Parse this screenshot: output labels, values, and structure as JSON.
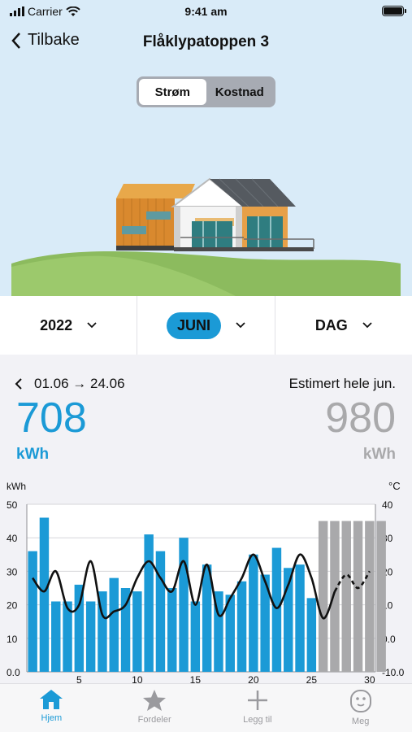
{
  "status_bar": {
    "carrier": "Carrier",
    "time": "9:41 am"
  },
  "nav": {
    "back_label": "Tilbake",
    "title": "Flåklypatoppen 3"
  },
  "segmented": {
    "options": [
      "Strøm",
      "Kostnad"
    ],
    "selected": "Strøm"
  },
  "selectors": {
    "year": "2022",
    "month": "JUNI",
    "granularity": "DAG"
  },
  "summary": {
    "period": "01.06 → 24.06",
    "used_value": "708",
    "used_unit": "kWh",
    "estimate_label": "Estimert hele jun.",
    "estimate_value": "980",
    "estimate_unit": "kWh"
  },
  "chart_data": {
    "type": "bar",
    "y_left_label": "kWh",
    "y_right_label": "°C",
    "y_left_ticks": [
      "50",
      "40",
      "30",
      "20",
      "10",
      "0.0"
    ],
    "y_right_ticks": [
      "40",
      "30",
      "20",
      "10",
      "0.0",
      "-10.0"
    ],
    "ylim": [
      0,
      50
    ],
    "y2lim": [
      -10,
      40
    ],
    "x_ticks": [
      "5",
      "10",
      "15",
      "20",
      "25",
      "30"
    ],
    "x_tick_values": [
      5,
      10,
      15,
      20,
      25,
      30
    ],
    "days": [
      1,
      2,
      3,
      4,
      5,
      6,
      7,
      8,
      9,
      10,
      11,
      12,
      13,
      14,
      15,
      16,
      17,
      18,
      19,
      20,
      21,
      22,
      23,
      24,
      25,
      26,
      27,
      28,
      29,
      30
    ],
    "actual_kwh": [
      36,
      46,
      21,
      21,
      26,
      21,
      24,
      28,
      25,
      24,
      41,
      36,
      25,
      40,
      21,
      32,
      24,
      23,
      27,
      35,
      29,
      37,
      31,
      32,
      22
    ],
    "estimated_kwh": [
      45,
      45,
      45,
      45,
      45,
      45
    ],
    "temperature_c": [
      18,
      14,
      20,
      9,
      10,
      23,
      7,
      8,
      10,
      18,
      23,
      18,
      14,
      23,
      10,
      22,
      7,
      12,
      18,
      25,
      17,
      9,
      16,
      25,
      18,
      6,
      14,
      19,
      15,
      20
    ],
    "colors": {
      "actual": "#1b9ad6",
      "estimated": "#a9a9ab",
      "temperature": "#111111"
    }
  },
  "tabs": [
    {
      "label": "Hjem",
      "icon": "home-icon",
      "active": true
    },
    {
      "label": "Fordeler",
      "icon": "star-icon",
      "active": false
    },
    {
      "label": "Legg til",
      "icon": "plus-icon",
      "active": false
    },
    {
      "label": "Meg",
      "icon": "face-icon",
      "active": false
    }
  ]
}
